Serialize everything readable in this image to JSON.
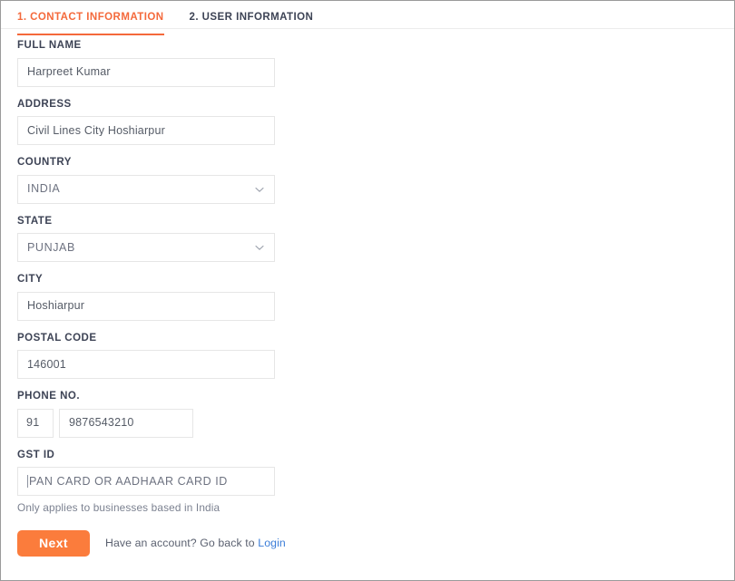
{
  "colors": {
    "accent_orange": "#f4693b",
    "button_orange": "#fb7c3c",
    "label_dark": "#3d4355",
    "value_gray": "#555b66",
    "helper_gray": "#7b8190",
    "link_blue": "#3b7dd8",
    "input_border": "#e6e6e6",
    "divider": "#ececec"
  },
  "tabs": [
    {
      "label": "1. CONTACT INFORMATION",
      "active": true
    },
    {
      "label": "2. USER INFORMATION",
      "active": false
    }
  ],
  "form": {
    "full_name": {
      "label": "FULL NAME",
      "value": "Harpreet Kumar",
      "placeholder": ""
    },
    "address": {
      "label": "ADDRESS",
      "value": "Civil Lines City Hoshiarpur",
      "placeholder": ""
    },
    "country": {
      "label": "COUNTRY",
      "value": "INDIA",
      "icon": "chevron-down-icon"
    },
    "state": {
      "label": "STATE",
      "value": "PUNJAB",
      "icon": "chevron-down-icon"
    },
    "city": {
      "label": "CITY",
      "value": "Hoshiarpur",
      "placeholder": ""
    },
    "postal_code": {
      "label": "POSTAL CODE",
      "value": "146001",
      "placeholder": ""
    },
    "phone": {
      "label": "PHONE NO.",
      "country_code": "91",
      "number": "9876543210"
    },
    "gst_id": {
      "label": "GST ID",
      "value": "",
      "placeholder": "PAN CARD OR AADHAAR CARD ID",
      "helper": "Only applies to businesses based in India"
    }
  },
  "footer": {
    "next_label": "Next",
    "account_prompt": "Have an account? Go back to",
    "login_label": "Login"
  }
}
